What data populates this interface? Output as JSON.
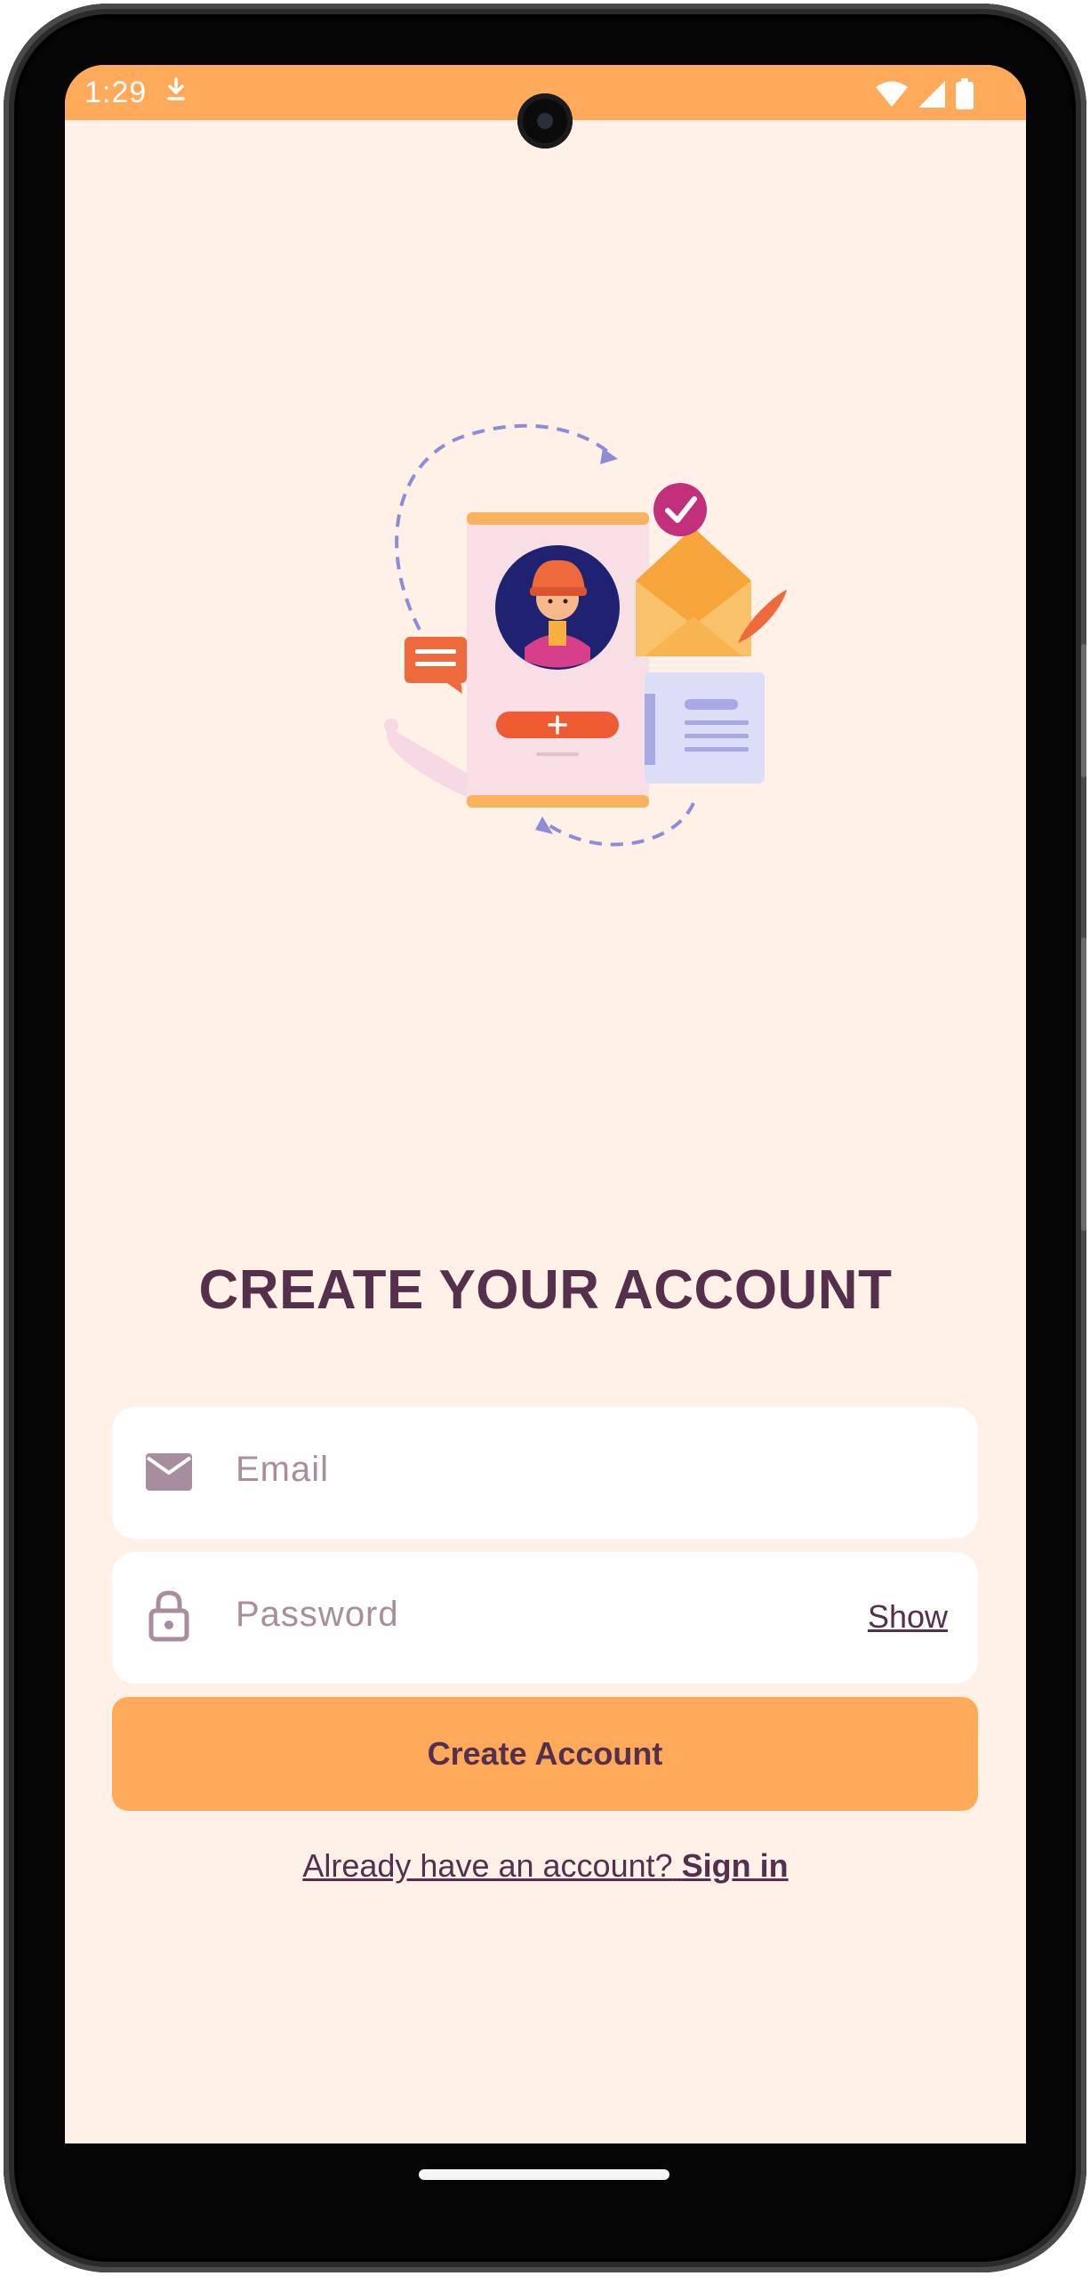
{
  "status_bar": {
    "time": "1:29",
    "color": "#FFA95A",
    "icons": [
      "download-icon",
      "wifi-icon",
      "signal-icon",
      "battery-icon"
    ]
  },
  "illustration": {
    "icons": [
      "profile-card-illustration",
      "envelope-icon",
      "checkmark-badge-icon",
      "chat-bubble-icon",
      "document-icon"
    ]
  },
  "form": {
    "title": "CREATE YOUR ACCOUNT",
    "email_placeholder": "Email",
    "password_placeholder": "Password",
    "show_label": "Show",
    "submit_label": "Create Account",
    "signin_prompt": "Already have an account?",
    "signin_link": "Sign in"
  },
  "colors": {
    "background": "#FFF1E7",
    "accent": "#FFA95A",
    "text": "#54304D",
    "placeholder": "#A78E9F"
  }
}
